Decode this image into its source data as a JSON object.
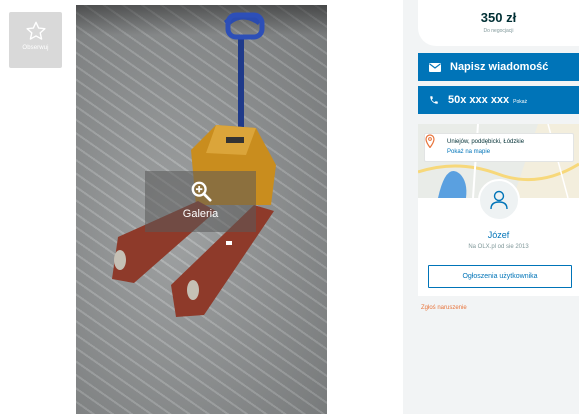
{
  "favorite": {
    "label": "Obserwuj",
    "icon": "star-icon"
  },
  "gallery": {
    "label": "Galeria",
    "icon": "zoom-in-icon"
  },
  "price": {
    "value": "350 zł",
    "note": "Do negocjacji"
  },
  "actions": {
    "message_label": "Napisz wiadomość",
    "message_icon": "envelope-icon",
    "phone_number": "50x xxx xxx",
    "phone_reveal": "Pokaż",
    "phone_icon": "phone-icon"
  },
  "location": {
    "text": "Uniejów, poddębicki, Łódzkie",
    "map_link": "Pokaż na mapie",
    "icon": "map-pin-icon"
  },
  "seller": {
    "name": "Józef",
    "since": "Na OLX.pl od sie 2013",
    "ads_button": "Ogłoszenia użytkownika",
    "avatar_icon": "user-icon"
  },
  "report_link": "Zgłoś naruszenie",
  "colors": {
    "primary": "#0074b8",
    "price_text": "#002f34",
    "report": "#e8743b",
    "side_bg": "#f2f4f5"
  }
}
